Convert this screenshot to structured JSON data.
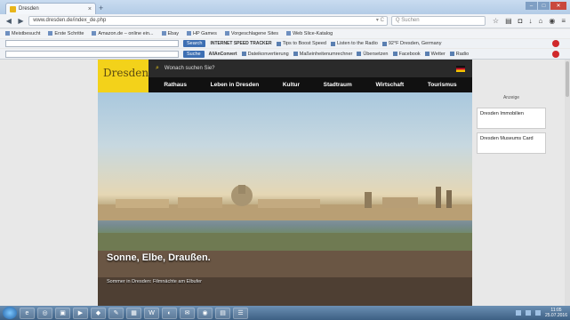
{
  "browser": {
    "tab_title": "Dresden",
    "tab_close": "×",
    "new_tab": "+",
    "url": "www.dresden.de/index_de.php",
    "search_placeholder": "Q Suchen",
    "bookmarks": [
      "Meistbesucht",
      "Erste Schritte",
      "Amazon.de – online ein...",
      "Ebay",
      "HP Games",
      "Vorgeschlagene Sites",
      "Web Slice-Katalog"
    ],
    "toolbar1": {
      "search_button": "Search",
      "items": [
        "INTERNET SPEED TRACKER",
        "Tips to Boost Speed",
        "Listen to the Radio",
        "92°F Dresden, Germany"
      ]
    },
    "toolbar2": {
      "search_button": "Suche",
      "items": [
        "AllAnConvert",
        "Dateikonvertierung",
        "Maßeinheitenumrechner",
        "Übersetzen",
        "Facebook",
        "Wetter",
        "Radio"
      ]
    }
  },
  "site": {
    "logo_text": "Dresden.",
    "search_label": "Wonach suchen Sie?",
    "menu": [
      "Rathaus",
      "Leben in Dresden",
      "Kultur",
      "Stadtraum",
      "Wirtschaft",
      "Tourismus"
    ],
    "hero_title": "Sonne, Elbe, Draußen.",
    "hero_subtitle": "Sommer in Dresden: Filmnächte am Elbufer",
    "ad_label": "Anzeige",
    "ads": [
      "Dresden Immobilien",
      "Dresden Museums Card"
    ]
  },
  "taskbar": {
    "time": "11:05",
    "date": "25.07.2016"
  },
  "colors": {
    "site_yellow": "#f3d21a",
    "menu_black": "#111111"
  }
}
